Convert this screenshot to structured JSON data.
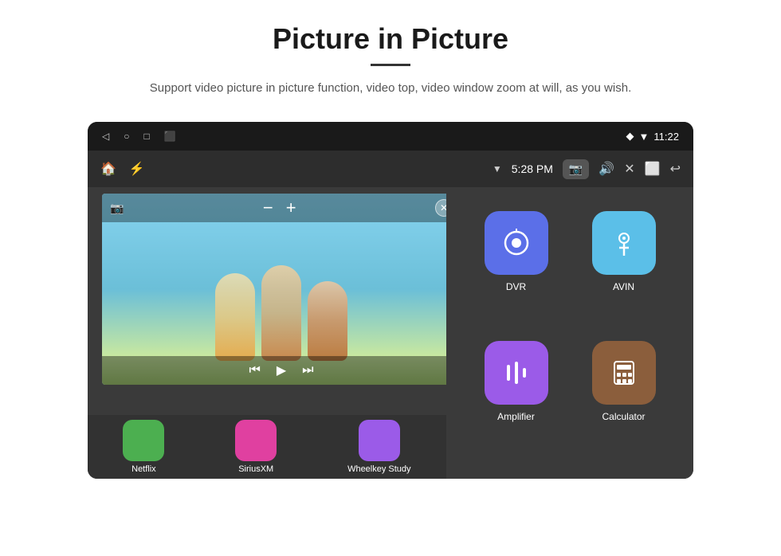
{
  "header": {
    "title": "Picture in Picture",
    "subtitle": "Support video picture in picture function, video top, video window zoom at will, as you wish."
  },
  "statusBar": {
    "time": "11:22",
    "wifi": "▼",
    "signal": "▼"
  },
  "appBar": {
    "time": "5:28 PM",
    "icons": [
      "🏠",
      "⚡",
      "📷",
      "🔊",
      "✕",
      "⬜",
      "↩"
    ]
  },
  "apps": [
    {
      "id": "dvr",
      "label": "DVR",
      "color": "#5b6fe8",
      "icon": "📡"
    },
    {
      "id": "avin",
      "label": "AVIN",
      "color": "#5bbfe8",
      "icon": "🎛"
    },
    {
      "id": "amplifier",
      "label": "Amplifier",
      "color": "#9b5be8",
      "icon": "🎚"
    },
    {
      "id": "calculator",
      "label": "Calculator",
      "color": "#8B5E3C",
      "icon": "🧮"
    }
  ],
  "bottomApps": [
    {
      "id": "netflix",
      "label": "Netflix",
      "color": "#4caf50"
    },
    {
      "id": "siriusxm",
      "label": "SiriusXM",
      "color": "#e040a0"
    },
    {
      "id": "wheelkey",
      "label": "Wheelkey Study",
      "color": "#9b5be8"
    }
  ]
}
